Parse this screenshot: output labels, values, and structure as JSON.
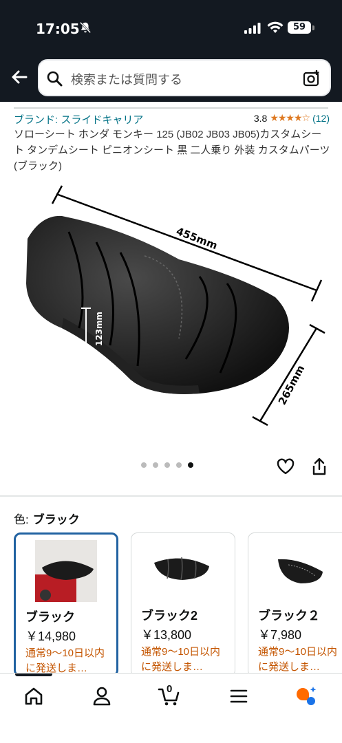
{
  "status": {
    "time": "17:05",
    "battery": "59"
  },
  "search": {
    "placeholder": "検索または質問する"
  },
  "product": {
    "brand": "ブランド: スライドキャリア",
    "rating": "3.8",
    "stars": "★★★★☆",
    "review_count": "(12)",
    "title": "ソローシート ホンダ モンキー 125 (JB02 JB03 JB05)カスタムシート タンデムシート ピニオンシート 黒 二人乗り 外装 カスタムパーツ (ブラック)",
    "image_labels": {
      "length": "455mm",
      "height": "123mm",
      "width": "265mm"
    },
    "image_count": 5,
    "image_index": 5
  },
  "color": {
    "label": "色:",
    "selected": "ブラック"
  },
  "variants": [
    {
      "name": "ブラック",
      "price": "￥14,980",
      "shipping": "通常9～10日以内に発送しま…"
    },
    {
      "name": "ブラック2",
      "price": "￥13,800",
      "shipping": "通常9～10日以内に発送しま…"
    },
    {
      "name": "ブラック２",
      "price": "￥7,980",
      "shipping": "通常9～10日以内に発送しま…"
    }
  ],
  "nav": {
    "cart_count": "0"
  },
  "icons": [
    "bell-slash-icon",
    "signal-icon",
    "wifi-icon",
    "battery-icon",
    "back-arrow-icon",
    "search-icon",
    "camera-icon",
    "heart-icon",
    "share-icon",
    "home-icon",
    "account-icon",
    "cart-icon",
    "menu-icon",
    "rufus-icon"
  ],
  "colors": {
    "header_bg": "#131921",
    "link": "#007185",
    "star": "#de7921",
    "shipping": "#c45500",
    "selected_border": "#2162a1"
  }
}
